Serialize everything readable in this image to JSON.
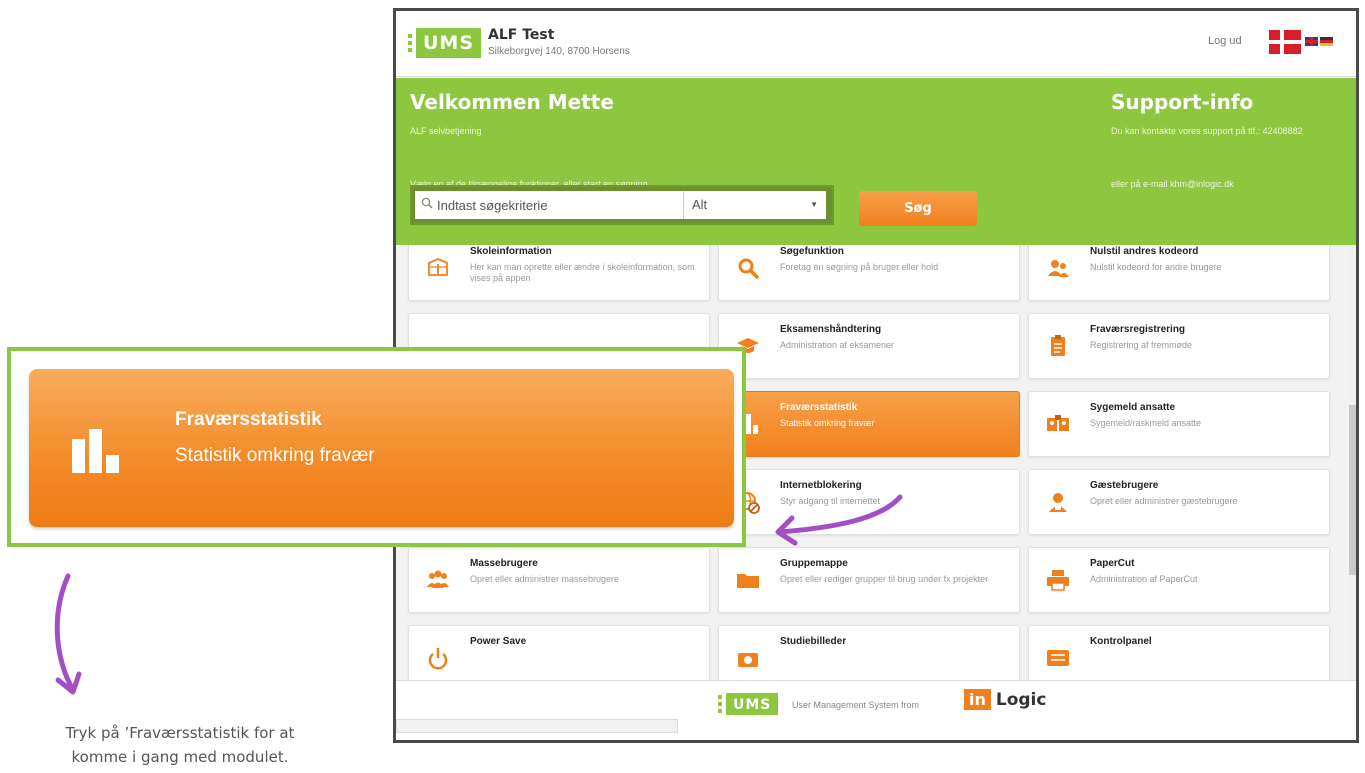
{
  "header": {
    "logo_text": "UMS",
    "org_name": "ALF Test",
    "org_address": "Silkeborgvej 140, 8700 Horsens",
    "logout_label": "Log ud"
  },
  "banner": {
    "welcome_title": "Velkommen Mette",
    "welcome_line1": "ALF selvbetjening",
    "welcome_line2": "Vælg en af de tilgængelige funktioner, eller start en søgning",
    "support_title": "Support-info",
    "support_line1": "Du kan kontakte vores support på tlf.: 42408882",
    "support_line2": "eller på e-mail khm@inlogic.dk",
    "search_placeholder": "Indtast søgekriterie",
    "scope_value": "Alt",
    "search_button": "Søg"
  },
  "tiles": [
    {
      "title": "Skoleinformation",
      "desc": "Her kan man oprette eller ændre i skoleinformation, som vises på appen",
      "icon": "book-icon"
    },
    {
      "title": "Søgefunktion",
      "desc": "Foretag en søgning på bruger eller hold",
      "icon": "search-icon"
    },
    {
      "title": "Nulstil andres kodeord",
      "desc": "Nulstil kodeord for andre brugere",
      "icon": "users-reset-icon"
    },
    {
      "title": "Eksamenshåndtering",
      "desc": "Administration af eksamener",
      "icon": "graduation-cap-icon"
    },
    {
      "title": "Fraværsregistrering",
      "desc": "Registrering af fremmøde",
      "icon": "clipboard-icon"
    },
    {
      "title": "Fraværsstatistik",
      "desc": "Statistik omkring fravær",
      "icon": "bar-chart-icon"
    },
    {
      "title": "Sygemeld ansatte",
      "desc": "Sygemeld/raskmeld ansatte",
      "icon": "id-cards-icon"
    },
    {
      "title": "Internetblokering",
      "desc": "Styr adgang til internettet",
      "icon": "blocked-globe-icon"
    },
    {
      "title": "Gæstebrugere",
      "desc": "Opret eller administrer gæstebrugere",
      "icon": "guest-user-icon"
    },
    {
      "title": "Massebrugere",
      "desc": "Opret eller administrer massebrugere",
      "icon": "group-icon"
    },
    {
      "title": "Gruppemappe",
      "desc": "Opret eller rediger grupper til brug under fx projekter",
      "icon": "folder-icon"
    },
    {
      "title": "PaperCut",
      "desc": "Administration af PaperCut",
      "icon": "printer-icon"
    },
    {
      "title": "Power Save",
      "desc": "",
      "icon": "power-icon"
    },
    {
      "title": "Studiebilleder",
      "desc": "",
      "icon": "camera-icon"
    },
    {
      "title": "Kontrolpanel",
      "desc": "",
      "icon": "control-panel-icon"
    }
  ],
  "footer": {
    "logo_text": "UMS",
    "text": "User Management System from",
    "inlogic_in": "in",
    "inlogic_text": "Logic"
  },
  "callout": {
    "title": "Fraværsstatistik",
    "desc": "Statistik omkring fravær",
    "icon": "bar-chart-icon"
  },
  "caption": {
    "line1": "Tryk på ’Fraværsstatistik for at",
    "line2": "komme i gang med modulet."
  },
  "colors": {
    "brand_green": "#8dc63f",
    "accent_orange": "#f0801c",
    "annotation_purple": "#a24fc4"
  }
}
